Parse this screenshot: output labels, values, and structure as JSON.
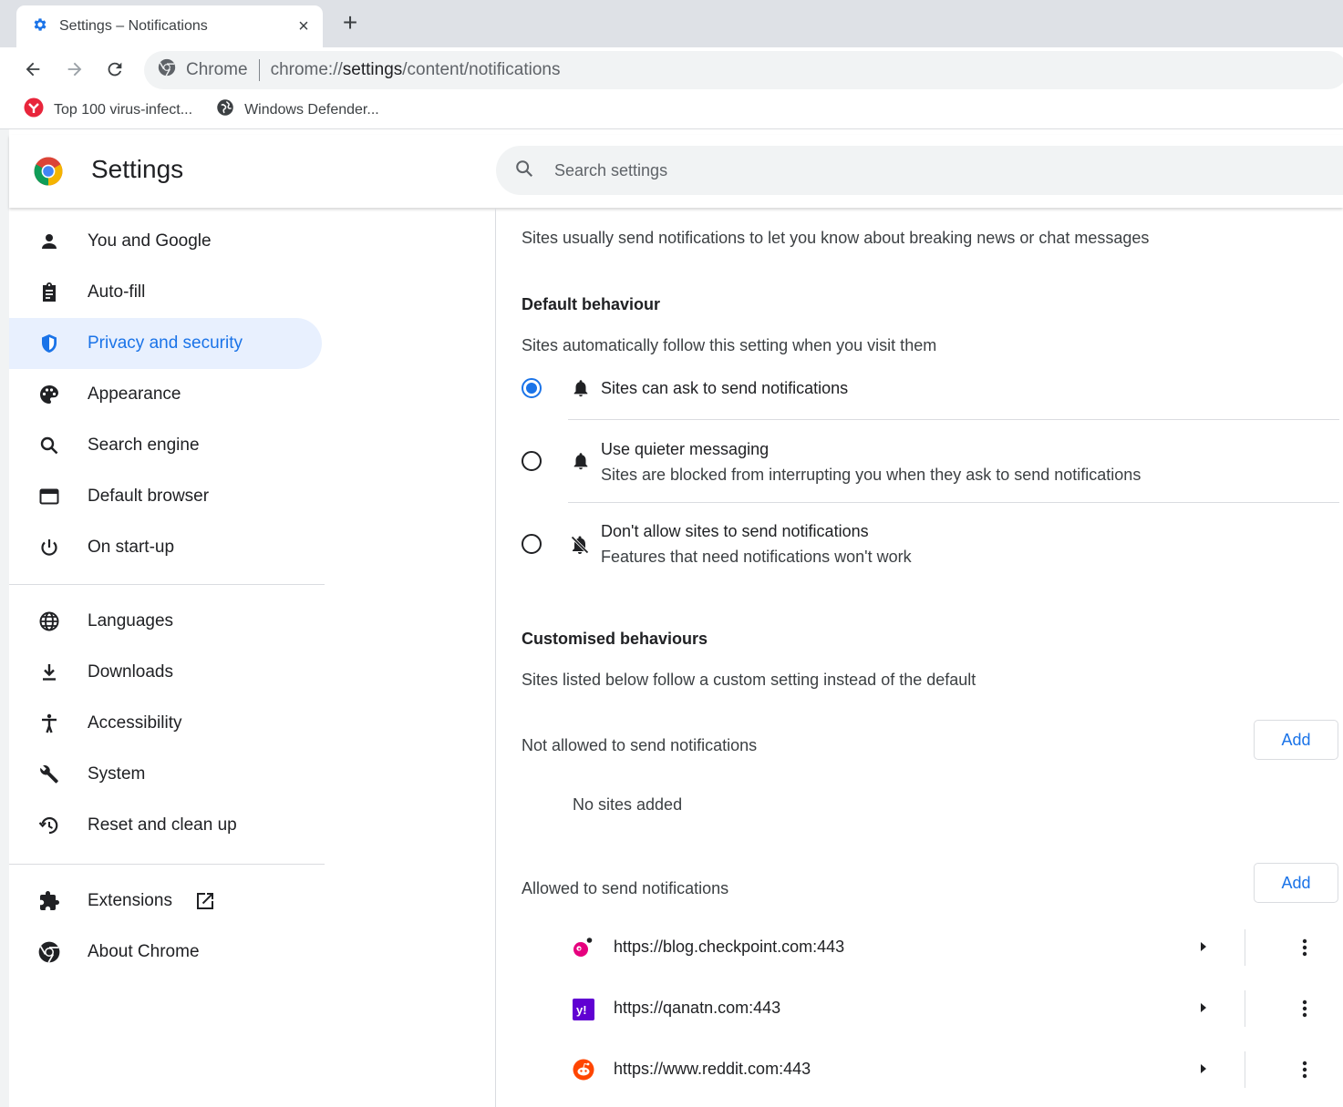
{
  "browser": {
    "tab_title": "Settings – Notifications",
    "tab_close": "×",
    "new_tab": "+",
    "omnibox_site": "Chrome",
    "omnibox_url_prefix": "chrome://",
    "omnibox_url_host": "settings",
    "omnibox_url_path": "/content/notifications",
    "bookmarks": [
      {
        "label": "Top 100 virus-infect...",
        "icon": "red-bookmark-icon"
      },
      {
        "label": "Windows Defender...",
        "icon": "globe-bookmark-icon"
      }
    ]
  },
  "header": {
    "title": "Settings",
    "search_placeholder": "Search settings"
  },
  "sidebar": {
    "items": [
      {
        "label": "You and Google",
        "icon": "person-icon"
      },
      {
        "label": "Auto-fill",
        "icon": "clipboard-icon"
      },
      {
        "label": "Privacy and security",
        "icon": "shield-icon",
        "active": true
      },
      {
        "label": "Appearance",
        "icon": "palette-icon"
      },
      {
        "label": "Search engine",
        "icon": "search-icon"
      },
      {
        "label": "Default browser",
        "icon": "browser-window-icon"
      },
      {
        "label": "On start-up",
        "icon": "power-icon"
      },
      {
        "label": "Languages",
        "icon": "globe-icon"
      },
      {
        "label": "Downloads",
        "icon": "download-icon"
      },
      {
        "label": "Accessibility",
        "icon": "accessibility-icon"
      },
      {
        "label": "System",
        "icon": "wrench-icon"
      },
      {
        "label": "Reset and clean up",
        "icon": "history-icon"
      },
      {
        "label": "Extensions",
        "icon": "puzzle-icon"
      },
      {
        "label": "About Chrome",
        "icon": "chrome-icon"
      }
    ]
  },
  "content": {
    "intro": "Sites usually send notifications to let you know about breaking news or chat messages",
    "default_heading": "Default behaviour",
    "default_sub": "Sites automatically follow this setting when you visit them",
    "options": [
      {
        "title": "Sites can ask to send notifications",
        "sub": "",
        "selected": true
      },
      {
        "title": "Use quieter messaging",
        "sub": "Sites are blocked from interrupting you when they ask to send notifications",
        "selected": false
      },
      {
        "title": "Don't allow sites to send notifications",
        "sub": "Features that need notifications won't work",
        "selected": false
      }
    ],
    "custom_heading": "Customised behaviours",
    "custom_sub": "Sites listed below follow a custom setting instead of the default",
    "blocked_label": "Not allowed to send notifications",
    "blocked_empty": "No sites added",
    "allowed_label": "Allowed to send notifications",
    "add_label": "Add",
    "allowed_sites": [
      {
        "url": "https://blog.checkpoint.com:443",
        "icon": "checkpoint-favicon"
      },
      {
        "url": "https://qanatn.com:443",
        "icon": "yahoo-favicon"
      },
      {
        "url": "https://www.reddit.com:443",
        "icon": "reddit-favicon"
      }
    ]
  },
  "colors": {
    "accent": "#1a73e8",
    "active_bg": "#e8f0fe",
    "tabstrip": "#dee1e6"
  }
}
